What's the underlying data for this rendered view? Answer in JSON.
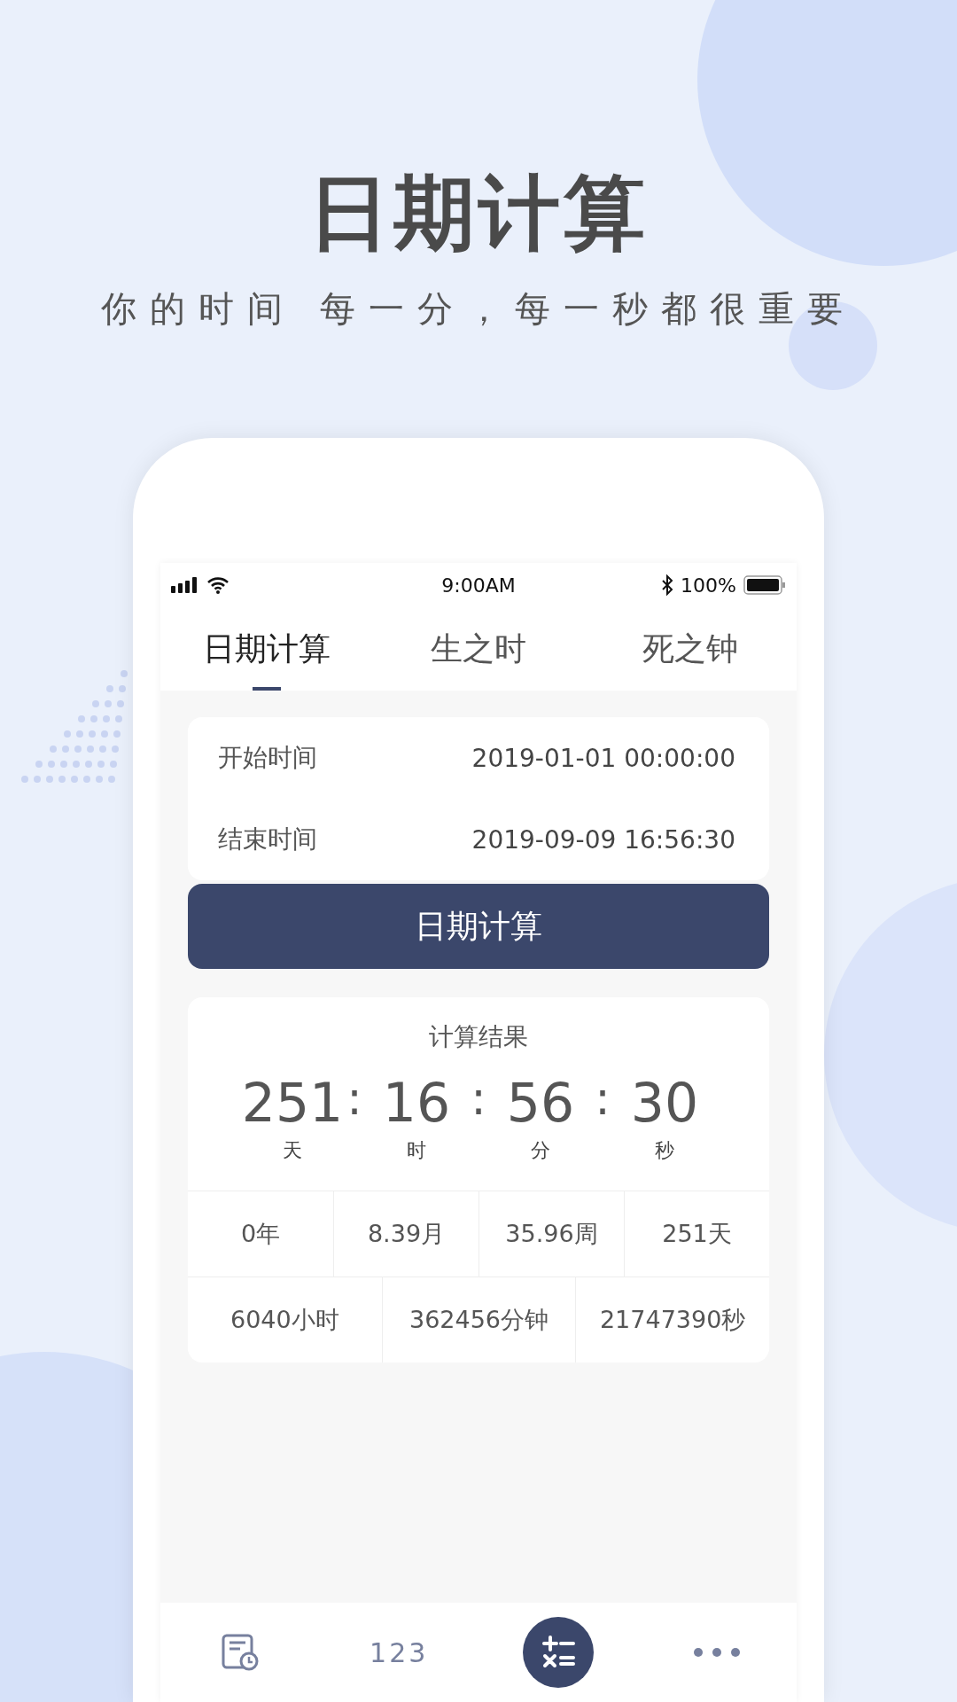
{
  "headline": "日期计算",
  "tagline": "你的时间 每一分，每一秒都很重要",
  "status_bar": {
    "time": "9:00AM",
    "battery": "100%"
  },
  "tabs": [
    {
      "label": "日期计算",
      "selected": true
    },
    {
      "label": "生之时",
      "selected": false
    },
    {
      "label": "死之钟",
      "selected": false
    }
  ],
  "inputs": [
    {
      "label": "开始时间",
      "value": "2019-01-01 00:00:00"
    },
    {
      "label": "结束时间",
      "value": "2019-09-09 16:56:30"
    }
  ],
  "calculate_button": "日期计算",
  "result": {
    "title": "计算结果",
    "separator": ":",
    "counter": [
      {
        "value": "251",
        "unit": "天"
      },
      {
        "value": "16",
        "unit": "时"
      },
      {
        "value": "56",
        "unit": "分"
      },
      {
        "value": "30",
        "unit": "秒"
      }
    ],
    "row_1": [
      "0年",
      "8.39月",
      "35.96周",
      "251天"
    ],
    "row_2": [
      "6040小时",
      "362456分钟",
      "21747390秒"
    ]
  },
  "bottom_nav": [
    {
      "kind": "history",
      "selected": false
    },
    {
      "kind": "numbers",
      "label": "123",
      "selected": false
    },
    {
      "kind": "calculator",
      "selected": true
    },
    {
      "kind": "more",
      "selected": false
    }
  ]
}
